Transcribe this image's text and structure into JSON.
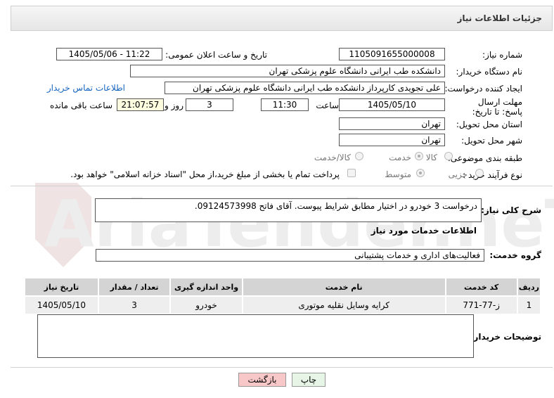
{
  "header": {
    "title": "جزئیات اطلاعات نیاز"
  },
  "form": {
    "need_number_label": "شماره نیاز:",
    "need_number": "1105091655000008",
    "announce_label": "تاریخ و ساعت اعلان عمومی:",
    "announce_value": "1405/05/06 - 11:22",
    "buyer_org_label": "نام دستگاه خریدار:",
    "buyer_org": "دانشکده طب ایرانی دانشگاه علوم پزشکی تهران",
    "creator_label": "ایجاد کننده درخواست:",
    "creator": "علی تجویدی کارپرداز دانشکده طب ایرانی دانشگاه علوم پزشکی تهران",
    "contact_link": "اطلاعات تماس خریدار",
    "deadline_label": "مهلت ارسال پاسخ: تا تاریخ:",
    "deadline_date": "1405/05/10",
    "hour_label": "ساعت",
    "deadline_time": "11:30",
    "days_value": "3",
    "days_label": "روز و",
    "remaining_time": "21:07:57",
    "remaining_label": "ساعت باقی مانده",
    "province_label": "استان محل تحویل:",
    "province": "تهران",
    "city_label": "شهر محل تحویل:",
    "city": "تهران",
    "category_label": "طبقه بندی موضوعی:",
    "category_options": [
      "کالا",
      "خدمت",
      "کالا/خدمت"
    ],
    "category_selected": "خدمت",
    "process_label": "نوع فرآیند خرید :",
    "process_options": [
      "جزیی",
      "متوسط"
    ],
    "process_selected": "متوسط",
    "payment_note": "پرداخت تمام یا بخشی از مبلغ خرید،از محل \"اسناد خزانه اسلامی\" خواهد بود."
  },
  "description": {
    "label": "شرح کلی نیاز:",
    "text": "درخواست 3 خودرو در اختیار مطابق شرایط پیوست. آقای فاتح 09124573998."
  },
  "services": {
    "section_title": "اطلاعات خدمات مورد نیاز",
    "group_label": "گروه خدمت:",
    "group_value": "فعالیت‌های اداری و خدمات پشتیبانی",
    "columns": [
      "ردیف",
      "کد خدمت",
      "نام خدمت",
      "واحد اندازه گیری",
      "تعداد / مقدار",
      "تاریخ نیاز"
    ],
    "rows": [
      {
        "row": "1",
        "code": "ز-77-771",
        "name": "کرایه وسایل نقلیه موتوری",
        "unit": "خودرو",
        "qty": "3",
        "date": "1405/05/10"
      }
    ]
  },
  "buyer_notes": {
    "label": "توضیحات خریدار:",
    "value": ""
  },
  "buttons": {
    "print": "چاپ",
    "back": "بازگشت"
  },
  "watermark": {
    "text": "AriaTender.neT"
  },
  "colors": {
    "link": "#1565c0",
    "back_button": "#f8c8c8",
    "print_button": "#e6f5e6",
    "remaining_bg": "#fffde0"
  }
}
